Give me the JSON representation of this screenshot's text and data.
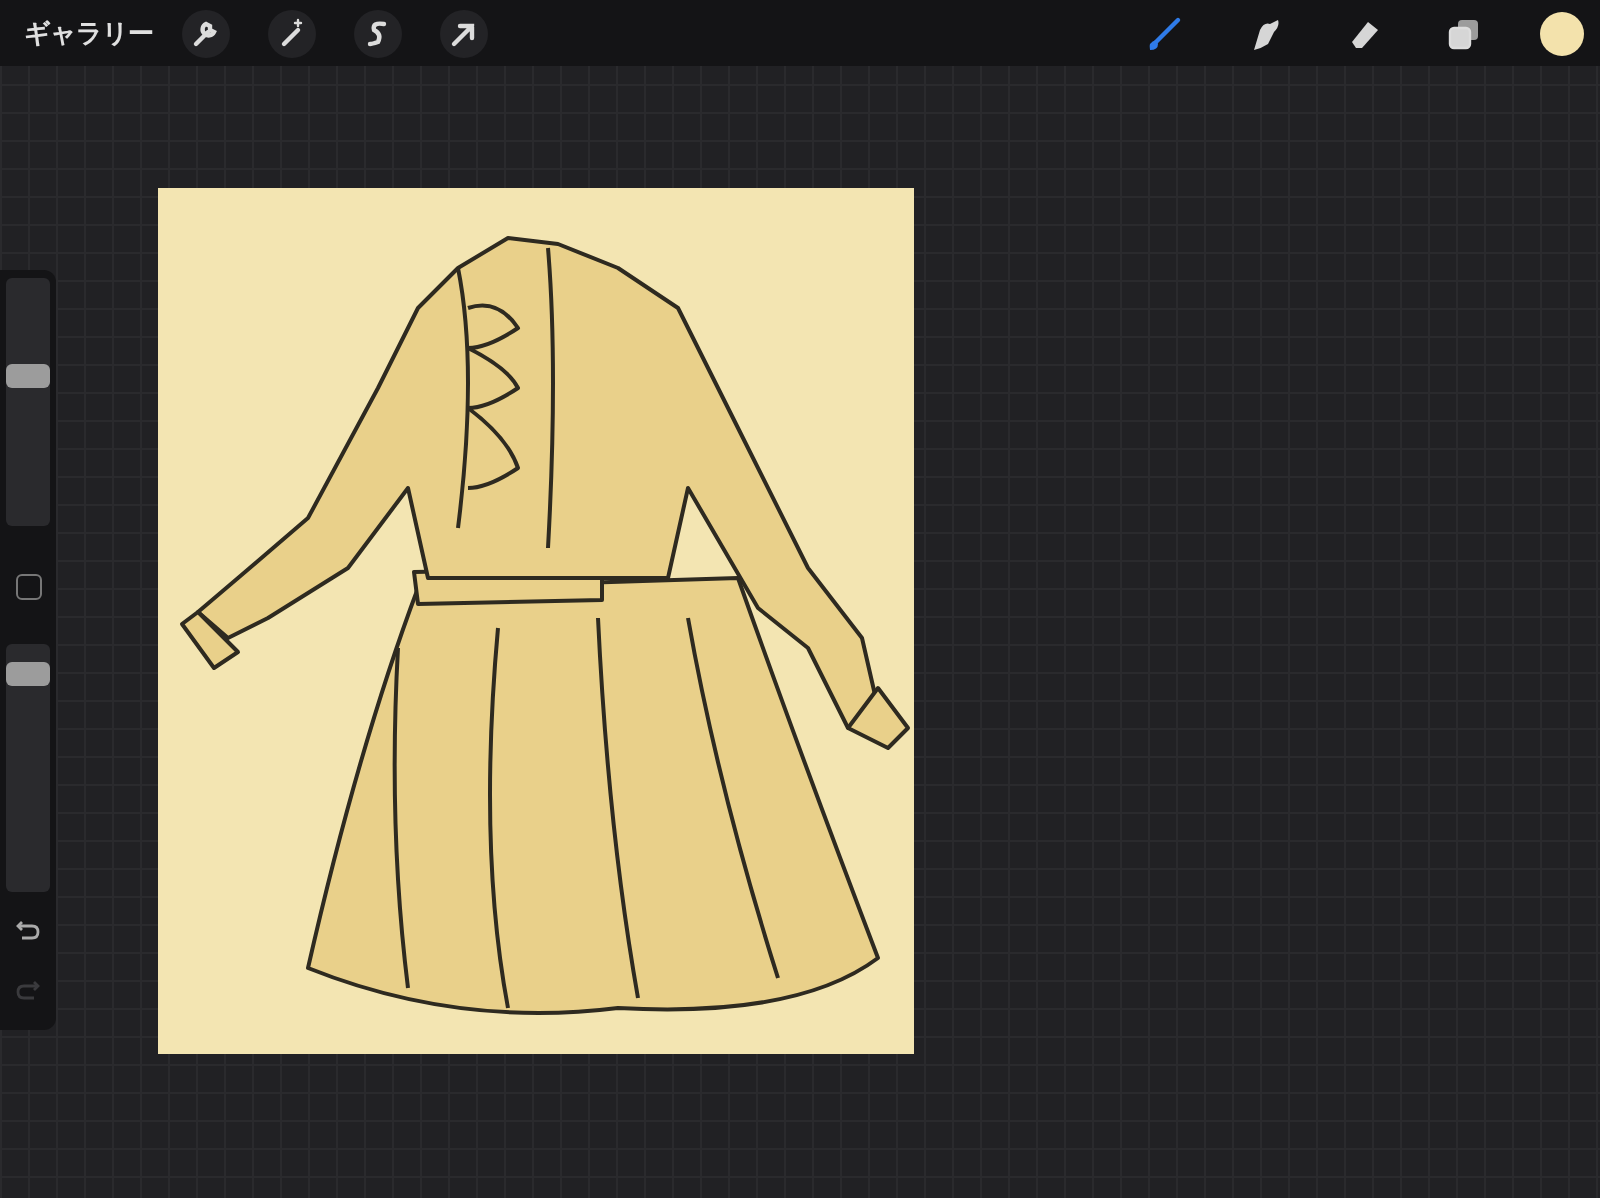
{
  "top_bar": {
    "gallery_label": "ギャラリー",
    "actions": [
      {
        "kind": "wrench"
      },
      {
        "kind": "wand"
      },
      {
        "kind": "selection"
      },
      {
        "kind": "arrow"
      }
    ],
    "tools": [
      {
        "kind": "brush",
        "selected": true
      },
      {
        "kind": "smudge",
        "selected": false
      },
      {
        "kind": "eraser",
        "selected": false
      },
      {
        "kind": "layers",
        "selected": false
      }
    ],
    "current_color": {
      "color": "#f3e2ac"
    }
  },
  "sidebar": {
    "sliders": [
      {
        "level": 0.62
      },
      {
        "level": 0.92
      }
    ],
    "undo": {
      "disabled": false
    },
    "redo": {
      "disabled": true
    }
  }
}
